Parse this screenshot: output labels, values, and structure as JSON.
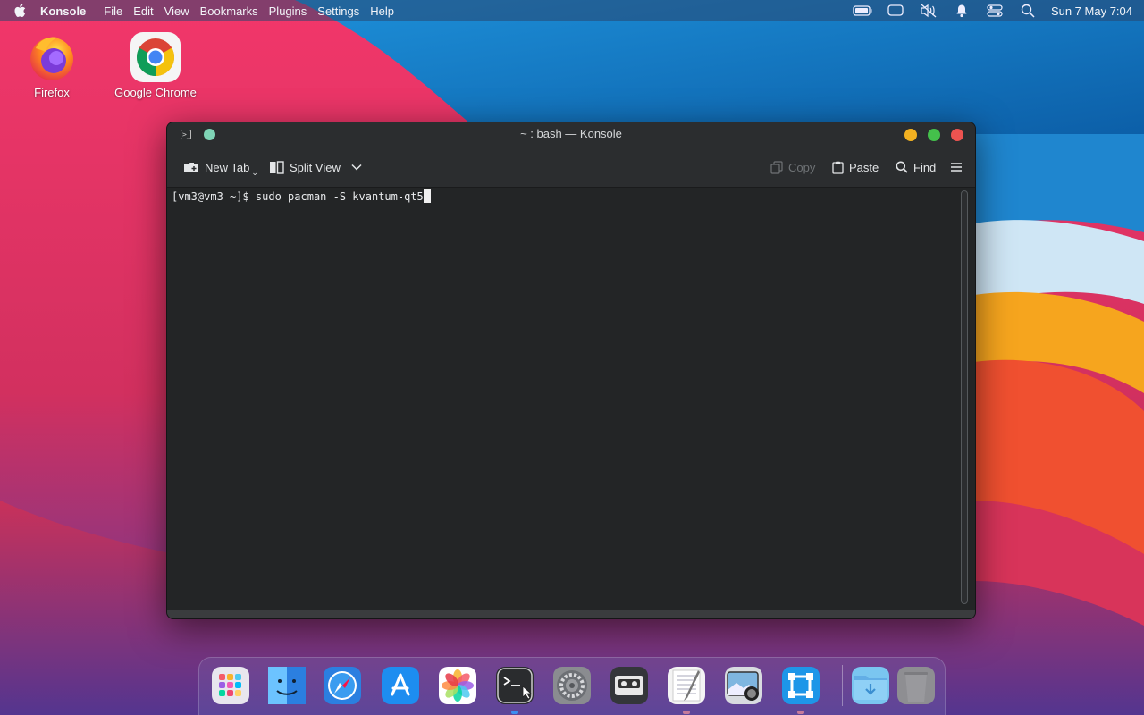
{
  "menubar": {
    "app_name": "Konsole",
    "menus": [
      "File",
      "Edit",
      "View",
      "Bookmarks",
      "Plugins",
      "Settings",
      "Help"
    ],
    "clock": "Sun 7 May 7:04",
    "tray_icons": [
      "battery-icon",
      "display-icon",
      "volume-muted-icon",
      "notification-bell-icon",
      "control-center-icon",
      "search-icon"
    ]
  },
  "desktop": {
    "icons": [
      {
        "label": "Firefox",
        "icon": "firefox-icon"
      },
      {
        "label": "Google Chrome",
        "icon": "chrome-icon"
      }
    ]
  },
  "window": {
    "title": "~ : bash — Konsole",
    "toolbar": {
      "new_tab": "New Tab",
      "split_view": "Split View",
      "copy": "Copy",
      "paste": "Paste",
      "find": "Find"
    },
    "terminal": {
      "prompt": "[vm3@vm3 ~]$ ",
      "command": "sudo pacman -S kvantum-qt5"
    }
  },
  "dock": {
    "apps": [
      {
        "name": "launchpad",
        "icon": "launchpad-icon",
        "color": "#e8e6ee",
        "running": false
      },
      {
        "name": "finder",
        "icon": "finder-icon",
        "color": "#3a8ee8",
        "running": false
      },
      {
        "name": "safari",
        "icon": "safari-icon",
        "color": "#2b7fe0",
        "running": false
      },
      {
        "name": "app-store",
        "icon": "app-store-icon",
        "color": "#1d8df0",
        "running": false
      },
      {
        "name": "photos",
        "icon": "photos-icon",
        "color": "#ffffff",
        "running": false
      },
      {
        "name": "konsole",
        "icon": "terminal-icon",
        "color": "#2a2c2e",
        "running": true,
        "dot_color": "#3d8ef0"
      },
      {
        "name": "system-settings",
        "icon": "gear-icon",
        "color": "#8a8c90",
        "running": false
      },
      {
        "name": "cassette-player",
        "icon": "cassette-icon",
        "color": "#34363a",
        "running": false
      },
      {
        "name": "text-editor",
        "icon": "text-editor-icon",
        "color": "#f4f4f4",
        "running": true,
        "dot_color": "#c77a9a"
      },
      {
        "name": "screenshot",
        "icon": "screenshot-icon",
        "color": "#d8dbe0",
        "running": false
      },
      {
        "name": "xcode-like",
        "icon": "frame-icon",
        "color": "#1e96e8",
        "running": true,
        "dot_color": "#c77a9a"
      },
      {
        "name": "downloads",
        "icon": "downloads-folder-icon",
        "color": "#7ac6f0",
        "running": false
      },
      {
        "name": "trash",
        "icon": "trash-icon",
        "color": "#8e8e92",
        "running": false
      }
    ]
  },
  "colors": {
    "window_bg": "#232526",
    "titlebar_bg": "#2b2d2f",
    "close": "#ec5350",
    "maximize": "#44c04b",
    "minimize": "#f2b121"
  }
}
